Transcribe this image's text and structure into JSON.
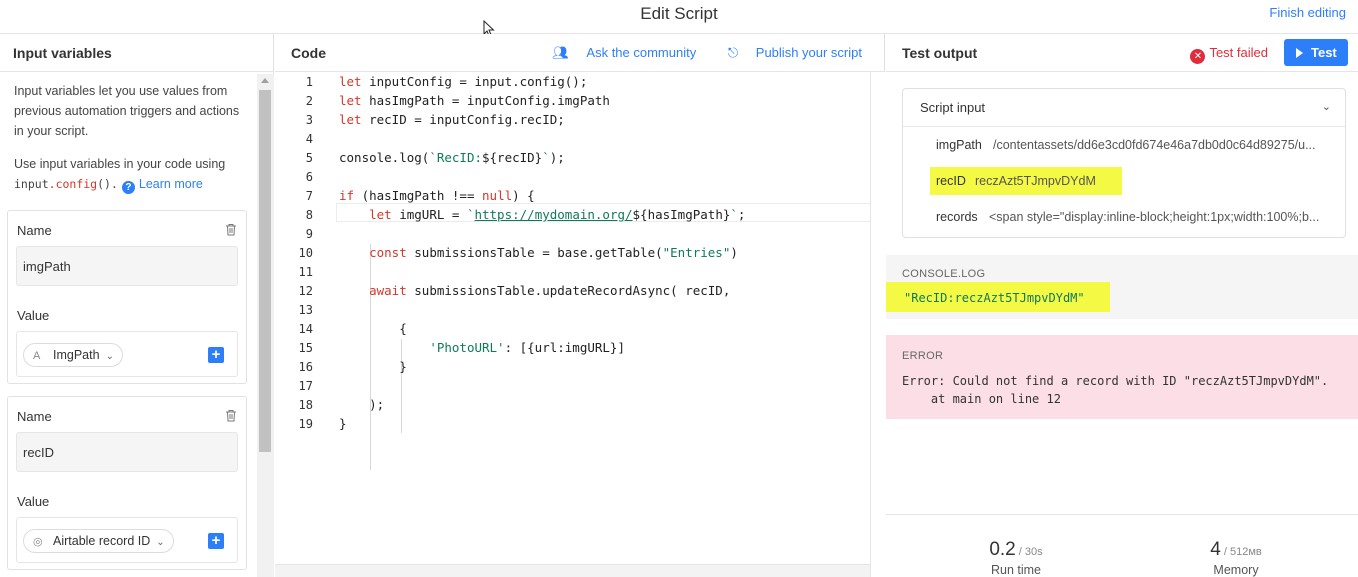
{
  "header": {
    "title": "Edit Script",
    "finish": "Finish editing"
  },
  "left": {
    "title": "Input variables",
    "desc": "Input variables let you use values from previous automation triggers and actions in your script.",
    "desc2_pre": "Use input variables in your code using",
    "code_input": "input",
    "code_dot": ".",
    "code_config": "config",
    "code_paren": "().",
    "learn_more": "Learn more",
    "vars": [
      {
        "name_label": "Name",
        "name_value": "imgPath",
        "value_label": "Value",
        "pill": "ImgPath"
      },
      {
        "name_label": "Name",
        "name_value": "recID",
        "value_label": "Value",
        "pill": "Airtable record ID"
      }
    ]
  },
  "code": {
    "title": "Code",
    "ask": "Ask the community",
    "publish": "Publish your script",
    "lines": [
      {
        "n": "1",
        "parts": [
          [
            "kw",
            "let"
          ],
          [
            "p",
            " inputConfig = input.config();"
          ]
        ]
      },
      {
        "n": "2",
        "parts": [
          [
            "kw",
            "let"
          ],
          [
            "p",
            " hasImgPath = inputConfig.imgPath"
          ]
        ]
      },
      {
        "n": "3",
        "parts": [
          [
            "kw",
            "let"
          ],
          [
            "p",
            " recID = inputConfig.recID;"
          ]
        ]
      },
      {
        "n": "4",
        "parts": []
      },
      {
        "n": "5",
        "parts": [
          [
            "p",
            "console.log("
          ],
          [
            "tpl",
            "`RecID:"
          ],
          [
            "p",
            "${recID}"
          ],
          [
            "tpl",
            "`"
          ],
          [
            "p",
            ");"
          ]
        ]
      },
      {
        "n": "6",
        "parts": []
      },
      {
        "n": "7",
        "parts": [
          [
            "kw",
            "if"
          ],
          [
            "p",
            " (hasImgPath "
          ],
          [
            "p",
            "!=="
          ],
          [
            "p",
            " "
          ],
          [
            "kw",
            "null"
          ],
          [
            "p",
            ") {"
          ]
        ]
      },
      {
        "n": "8",
        "parts": [
          [
            "p",
            "    "
          ],
          [
            "kw",
            "let"
          ],
          [
            "p",
            " imgURL = "
          ],
          [
            "tpl",
            "`"
          ],
          [
            "url",
            "https://mydomain.org/"
          ],
          [
            "p",
            "${hasImgPath}"
          ],
          [
            "tpl",
            "`"
          ],
          [
            "p",
            ";"
          ]
        ]
      },
      {
        "n": "9",
        "parts": []
      },
      {
        "n": "10",
        "parts": [
          [
            "p",
            "    "
          ],
          [
            "kw",
            "const"
          ],
          [
            "p",
            " submissionsTable = base.getTable("
          ],
          [
            "str",
            "\"Entries\""
          ],
          [
            "p",
            ")"
          ]
        ]
      },
      {
        "n": "11",
        "parts": []
      },
      {
        "n": "12",
        "parts": [
          [
            "p",
            "    "
          ],
          [
            "kw",
            "await"
          ],
          [
            "p",
            " submissionsTable.updateRecordAsync( recID,"
          ]
        ]
      },
      {
        "n": "13",
        "parts": []
      },
      {
        "n": "14",
        "parts": [
          [
            "p",
            "        {"
          ]
        ]
      },
      {
        "n": "15",
        "parts": [
          [
            "p",
            "            "
          ],
          [
            "str",
            "'PhotoURL'"
          ],
          [
            "p",
            ": [{url:imgURL}]"
          ]
        ]
      },
      {
        "n": "16",
        "parts": [
          [
            "p",
            "        }"
          ]
        ]
      },
      {
        "n": "17",
        "parts": []
      },
      {
        "n": "18",
        "parts": [
          [
            "p",
            "    );"
          ]
        ]
      },
      {
        "n": "19",
        "parts": [
          [
            "p",
            "}"
          ]
        ]
      }
    ]
  },
  "output": {
    "title": "Test output",
    "status": "Test failed",
    "test_button": "Test",
    "script_input": "Script input",
    "rows": [
      {
        "k": "imgPath",
        "v": "/contentassets/dd6e3cd0fd674e46a7db0d0c64d89275/u..."
      },
      {
        "k": "recID",
        "v": "reczAzt5TJmpvDYdM"
      },
      {
        "k": "records",
        "v": "<span style=\"display:inline-block;height:1px;width:100%;b..."
      }
    ],
    "console_label": "CONSOLE.LOG",
    "console_value": "\"RecID:reczAzt5TJmpvDYdM\"",
    "error_label": "ERROR",
    "error_text": "Error: Could not find a record with ID \"reczAzt5TJmpvDYdM\".\n    at main on line 12",
    "run_value": "0.2",
    "run_limit": " / 30s",
    "run_label": "Run time",
    "mem_value": "4",
    "mem_limit": " / 512мв",
    "mem_label": "Memory"
  },
  "colors": {
    "accent": "#2d7ff9",
    "error": "#e02c3c",
    "highlight": "#f4f944",
    "error_bg": "#fcdfe6"
  }
}
